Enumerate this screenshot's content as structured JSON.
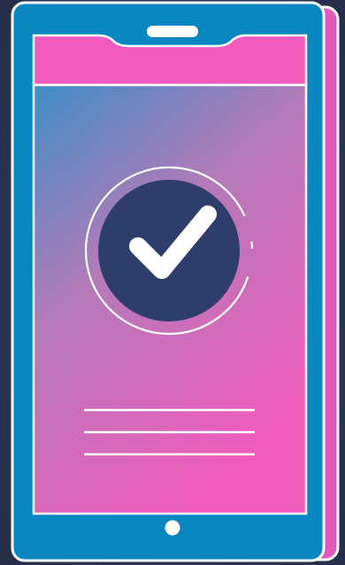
{
  "illustration": {
    "subject": "phone-success-check",
    "icon": "checkmark-icon",
    "colors": {
      "background": "#2c3550",
      "phone_body": "#0a86c0",
      "phone_shadow_layer": "#e05bbf",
      "outline": "#ffffff",
      "header_bar": "#f15bbd",
      "screen_gradient_top": "#3f8ec6",
      "screen_gradient_mid": "#b57ab8",
      "screen_gradient_bottom": "#f05cbc",
      "check_circle": "#2e3d6b",
      "check_mark": "#ffffff"
    },
    "text_lines_count": 3
  }
}
